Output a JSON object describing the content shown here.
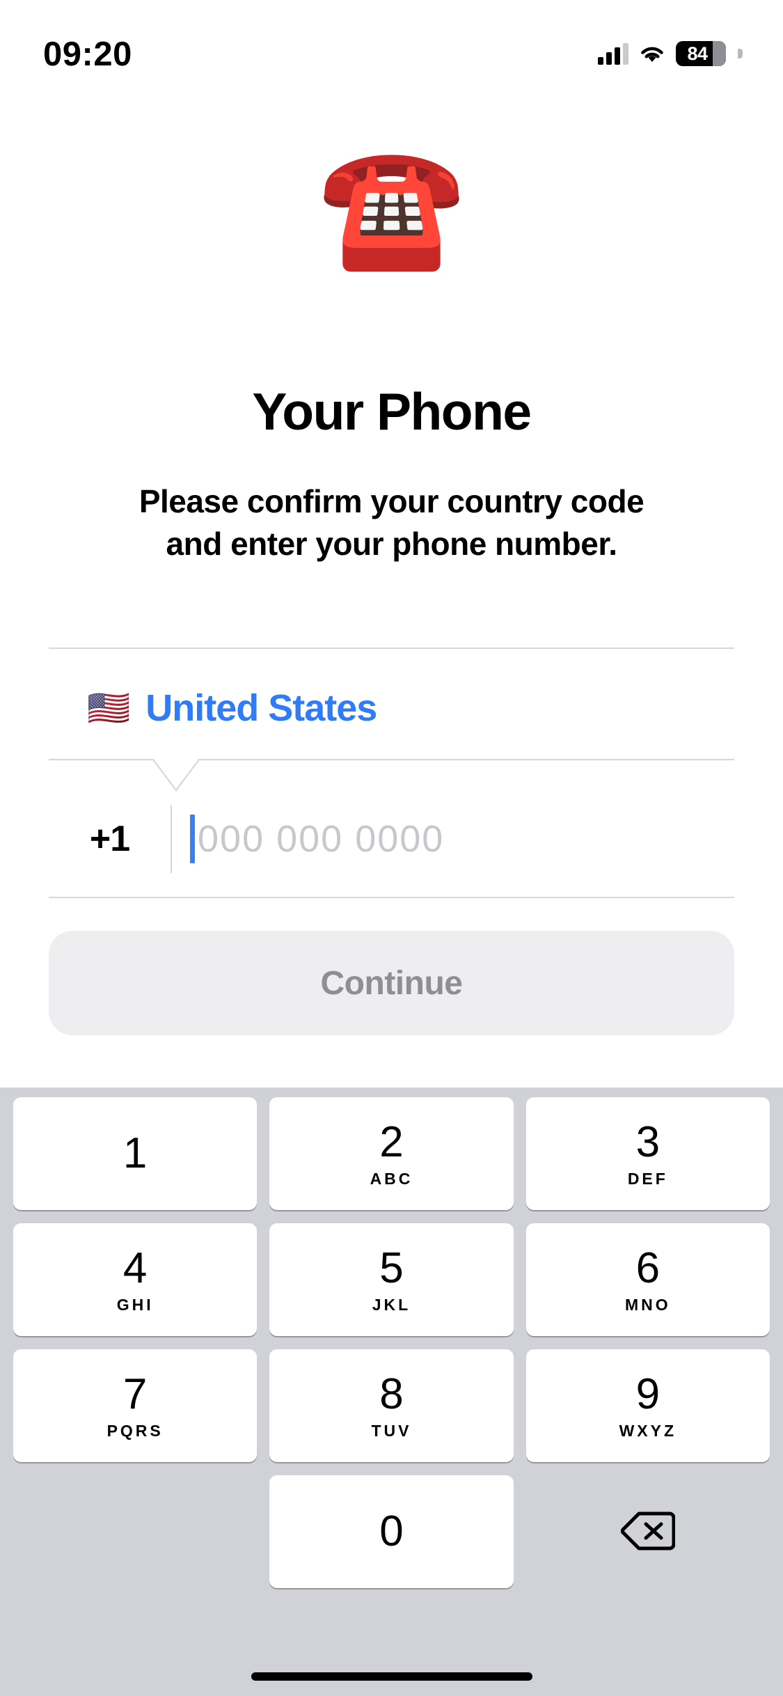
{
  "status_bar": {
    "time": "09:20",
    "battery_level": "84",
    "cellular_icon": "cellular-signal-icon",
    "wifi_icon": "wifi-icon",
    "battery_icon": "battery-icon"
  },
  "hero": {
    "emoji": "☎️",
    "emoji_name": "telephone-emoji",
    "title": "Your Phone",
    "subtitle_line1": "Please confirm your country code",
    "subtitle_line2": "and enter your phone number."
  },
  "form": {
    "country_flag": "🇺🇸",
    "country_name": "United States",
    "country_color": "#2f7cf6",
    "dial_code": "+1",
    "phone_placeholder": "000 000 0000",
    "phone_value": "",
    "caret_color": "#3b7ef4"
  },
  "actions": {
    "continue_label": "Continue",
    "continue_enabled": false,
    "continue_bg": "#eeeef0",
    "continue_text_color": "#8e8e93"
  },
  "keypad": {
    "background": "#d0d2d7",
    "keys": [
      {
        "digit": "1",
        "letters": ""
      },
      {
        "digit": "2",
        "letters": "ABC"
      },
      {
        "digit": "3",
        "letters": "DEF"
      },
      {
        "digit": "4",
        "letters": "GHI"
      },
      {
        "digit": "5",
        "letters": "JKL"
      },
      {
        "digit": "6",
        "letters": "MNO"
      },
      {
        "digit": "7",
        "letters": "PQRS"
      },
      {
        "digit": "8",
        "letters": "TUV"
      },
      {
        "digit": "9",
        "letters": "WXYZ"
      },
      {
        "digit": "0",
        "letters": ""
      }
    ],
    "delete_icon": "backspace-delete-icon"
  }
}
